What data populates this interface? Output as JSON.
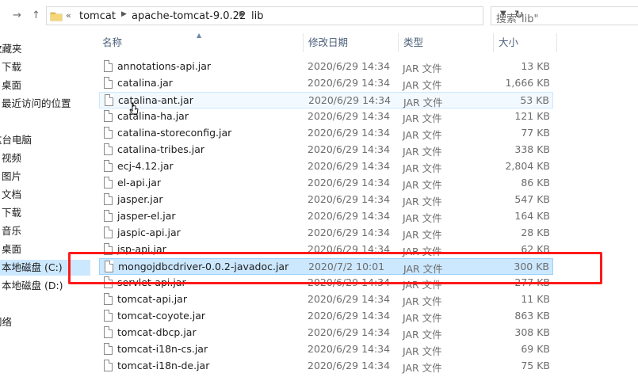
{
  "address_bar": {
    "overflow": "«",
    "crumbs": [
      "tomcat",
      "apache-tomcat-9.0.22",
      "lib"
    ],
    "search_placeholder": "搜索\"lib\""
  },
  "nav_pane": {
    "items": [
      {
        "label": "收藏夹"
      },
      {
        "label": "下载"
      },
      {
        "label": "桌面"
      },
      {
        "label": "最近访问的位置"
      },
      {
        "label": "这台电脑"
      },
      {
        "label": "视频"
      },
      {
        "label": "图片"
      },
      {
        "label": "文档"
      },
      {
        "label": "下载"
      },
      {
        "label": "音乐"
      },
      {
        "label": "桌面"
      },
      {
        "label": "本地磁盘 (C:)"
      },
      {
        "label": "本地磁盘 (D:)"
      },
      {
        "label": "网络"
      }
    ]
  },
  "columns": {
    "name": "名称",
    "date": "修改日期",
    "type": "类型",
    "size": "大小"
  },
  "files": [
    {
      "name": "annotations-api.jar",
      "date": "2020/6/29 14:34",
      "type": "JAR 文件",
      "size": "13 KB"
    },
    {
      "name": "catalina.jar",
      "date": "2020/6/29 14:34",
      "type": "JAR 文件",
      "size": "1,666 KB"
    },
    {
      "name": "catalina-ant.jar",
      "date": "2020/6/29 14:34",
      "type": "JAR 文件",
      "size": "53 KB"
    },
    {
      "name": "catalina-ha.jar",
      "date": "2020/6/29 14:34",
      "type": "JAR 文件",
      "size": "121 KB"
    },
    {
      "name": "catalina-storeconfig.jar",
      "date": "2020/6/29 14:34",
      "type": "JAR 文件",
      "size": "77 KB"
    },
    {
      "name": "catalina-tribes.jar",
      "date": "2020/6/29 14:34",
      "type": "JAR 文件",
      "size": "338 KB"
    },
    {
      "name": "ecj-4.12.jar",
      "date": "2020/6/29 14:34",
      "type": "JAR 文件",
      "size": "2,804 KB"
    },
    {
      "name": "el-api.jar",
      "date": "2020/6/29 14:34",
      "type": "JAR 文件",
      "size": "86 KB"
    },
    {
      "name": "jasper.jar",
      "date": "2020/6/29 14:34",
      "type": "JAR 文件",
      "size": "547 KB"
    },
    {
      "name": "jasper-el.jar",
      "date": "2020/6/29 14:34",
      "type": "JAR 文件",
      "size": "164 KB"
    },
    {
      "name": "jaspic-api.jar",
      "date": "2020/6/29 14:34",
      "type": "JAR 文件",
      "size": "28 KB"
    },
    {
      "name": "jsp-api.jar",
      "date": "2020/6/29 14:34",
      "type": "JAR 文件",
      "size": "62 KB"
    },
    {
      "name": "mongojdbcdriver-0.0.2-javadoc.jar",
      "date": "2020/7/2 10:01",
      "type": "JAR 文件",
      "size": "300 KB"
    },
    {
      "name": "servlet-api.jar",
      "date": "2020/6/29 14:34",
      "type": "JAR 文件",
      "size": "277 KB"
    },
    {
      "name": "tomcat-api.jar",
      "date": "2020/6/29 14:34",
      "type": "JAR 文件",
      "size": "11 KB"
    },
    {
      "name": "tomcat-coyote.jar",
      "date": "2020/6/29 14:34",
      "type": "JAR 文件",
      "size": "863 KB"
    },
    {
      "name": "tomcat-dbcp.jar",
      "date": "2020/6/29 14:34",
      "type": "JAR 文件",
      "size": "308 KB"
    },
    {
      "name": "tomcat-i18n-cs.jar",
      "date": "2020/6/29 14:34",
      "type": "JAR 文件",
      "size": "69 KB"
    },
    {
      "name": "tomcat-i18n-de.jar",
      "date": "2020/6/29 14:34",
      "type": "JAR 文件",
      "size": "75 KB"
    }
  ],
  "colors": {
    "selection": "#cce8ff",
    "annotation": "#ff1a1a"
  }
}
